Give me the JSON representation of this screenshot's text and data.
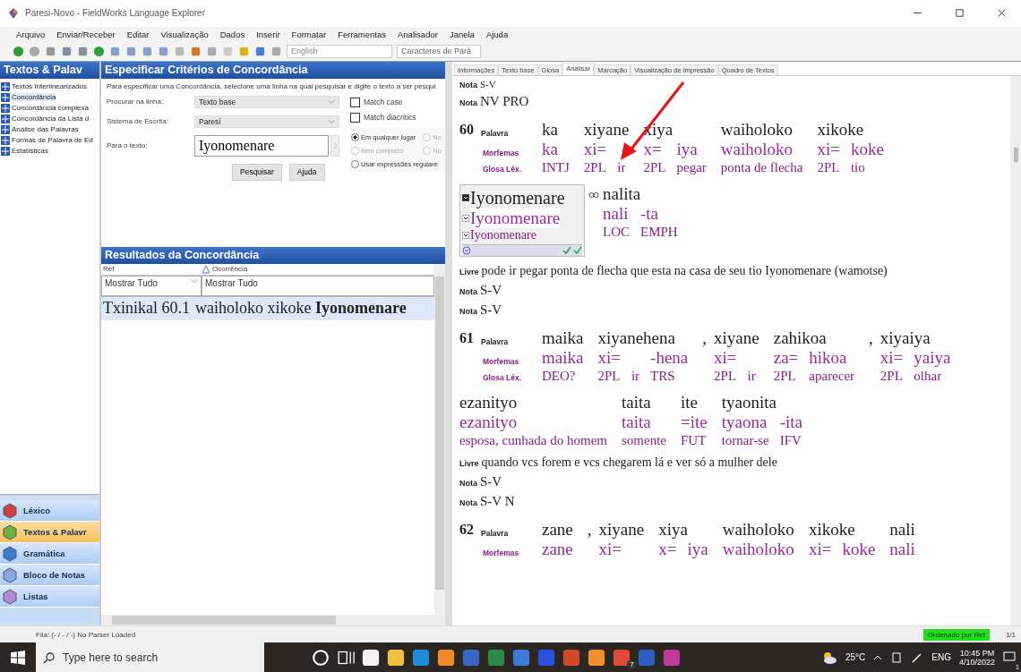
{
  "window": {
    "title": "Paresi-Novo - FieldWorks Language Explorer"
  },
  "menu": [
    "Arquivo",
    "Enviar/Receber",
    "Editar",
    "Visualização",
    "Dados",
    "Inserir",
    "Formatar",
    "Ferramentas",
    "Analisador",
    "Janela",
    "Ajuda"
  ],
  "toolbar": {
    "writing_system": "English",
    "style": "Caracteres de Pará"
  },
  "sidebar": {
    "title": "Textos & Palav",
    "items": [
      {
        "label": "Textos Interlinearizados",
        "selected": false
      },
      {
        "label": "Concordância",
        "selected": true
      },
      {
        "label": "Concordância complexa",
        "selected": false
      },
      {
        "label": "Concordância da Lista d",
        "selected": false
      },
      {
        "label": "Análise das Palavras",
        "selected": false
      },
      {
        "label": "Formas de Palavra de Ed",
        "selected": false
      },
      {
        "label": "Estatísticas",
        "selected": false
      }
    ],
    "areas": [
      {
        "label": "Léxico",
        "selected": false
      },
      {
        "label": "Textos & Palavr",
        "selected": true
      },
      {
        "label": "Gramática",
        "selected": false
      },
      {
        "label": "Bloco de Notas",
        "selected": false
      },
      {
        "label": "Listas",
        "selected": false
      }
    ]
  },
  "criteria": {
    "title": "Especificar Critérios de Concordância",
    "instructions": "Para especificar uma Concordância, selecione uma linha na qual pesquisar e digite o texto a ser pesqui",
    "fields": [
      {
        "label": "Procurar na linha:",
        "value": "Texto base",
        "kind": "combo"
      },
      {
        "label": "Sistema de Escrita:",
        "value": "Paresí",
        "kind": "combo"
      },
      {
        "label": "Para o texto:",
        "value": "Iyonomenare",
        "kind": "text"
      }
    ],
    "checkboxes": [
      {
        "label": "Match case",
        "checked": false
      },
      {
        "label": "Match diacritics",
        "checked": false
      }
    ],
    "match_options": [
      {
        "label": "Em qualquer lugar",
        "selected": true,
        "disabled": false
      },
      {
        "label": "No",
        "selected": false,
        "disabled": true
      },
      {
        "label": "Item completo",
        "selected": false,
        "disabled": true
      },
      {
        "label": "No",
        "selected": false,
        "disabled": true
      },
      {
        "label": "Usar expressões regulare",
        "selected": false,
        "disabled": false
      }
    ],
    "buttons": [
      "Pesquisar",
      "Ajuda"
    ]
  },
  "results": {
    "title": "Resultados da Concordância",
    "columns": [
      {
        "label": "Ref",
        "sorted": false
      },
      {
        "label": "Ocorrência",
        "sorted": true
      }
    ],
    "filters": [
      "Mostrar Tudo",
      "Mostrar Tudo"
    ],
    "rows": [
      {
        "ref": "Txinikal 60.1",
        "occurrence": "waiholoko xikoke **Iyonomenare**",
        "selected": true
      }
    ]
  },
  "text_tabs": [
    {
      "label": "Informações",
      "selected": false
    },
    {
      "label": "Texto base",
      "selected": false
    },
    {
      "label": "Glosa",
      "selected": false
    },
    {
      "label": "Analisar",
      "selected": true
    },
    {
      "label": "Marcação",
      "selected": false
    },
    {
      "label": "Visualização de Impressão",
      "selected": false
    },
    {
      "label": "Quadro de Textos",
      "selected": false
    }
  ],
  "interlinear": [
    {
      "kind": "note",
      "label": "Nota",
      "text": "S-V",
      "small": true
    },
    {
      "kind": "note",
      "label": "Nota",
      "text": "NV PRO",
      "small": false
    },
    {
      "kind": "bundle",
      "number": "60",
      "labels": [
        "Palavra",
        "Morfemas",
        "Glosa Léx."
      ],
      "lines": [
        [
          {
            "kind": "word",
            "word": "ka",
            "morphs": [
              {
                "form": "ka",
                "gloss": "INTJ"
              }
            ]
          },
          {
            "kind": "word",
            "word": "xiyane",
            "morphs": [
              {
                "form": "xi=",
                "gloss": "2PL"
              },
              {
                "gloss": "ir"
              }
            ]
          },
          {
            "kind": "word",
            "word": "xiya",
            "morphs": [
              {
                "form": "x=",
                "gloss": "2PL"
              },
              {
                "form": "iya",
                "gloss": "pegar"
              }
            ]
          },
          {
            "kind": "word",
            "word": "waiholoko",
            "morphs": [
              {
                "form": "waiholoko",
                "gloss": "ponta de flecha"
              }
            ]
          },
          {
            "kind": "word",
            "word": "xikoke",
            "morphs": [
              {
                "form": "xi=",
                "gloss": "2PL"
              },
              {
                "form": "koke",
                "gloss": "tio"
              }
            ]
          }
        ],
        [
          {
            "kind": "sandbox",
            "lines": [
              "Iyonomenare",
              "Iyonomenare",
              "Iyonomenare"
            ]
          },
          {
            "kind": "word",
            "word": "nalita",
            "morphs": [
              {
                "form": "nali",
                "gloss": "LOC"
              },
              {
                "form": "-ta",
                "gloss": "EMPH"
              }
            ]
          }
        ]
      ]
    },
    {
      "kind": "free",
      "label": "Livre",
      "text": "pode ir pegar ponta de flecha que esta na casa de seu tio Iyonomenare (wamotse)"
    },
    {
      "kind": "note",
      "label": "Nota",
      "text": "S-V",
      "small": false
    },
    {
      "kind": "note",
      "label": "Nota",
      "text": "S-V",
      "small": false
    },
    {
      "kind": "bundle",
      "number": "61",
      "labels": [
        "Palavra",
        "Morfemas",
        "Glosa Léx."
      ],
      "lines": [
        [
          {
            "kind": "word",
            "word": "maika",
            "morphs": [
              {
                "form": "maika",
                "gloss": "DEO?"
              }
            ]
          },
          {
            "kind": "word",
            "word": "xiyanehena",
            "morphs": [
              {
                "form": "xi=",
                "gloss": "2PL"
              },
              {
                "gloss": "ir"
              },
              {
                "form": "-hena",
                "gloss": "TRS"
              }
            ]
          },
          {
            "kind": "punct",
            "text": ","
          },
          {
            "kind": "word",
            "word": "xiyane",
            "morphs": [
              {
                "form": "xi=",
                "gloss": "2PL"
              },
              {
                "gloss": "ir"
              }
            ]
          },
          {
            "kind": "word",
            "word": "zahikoa",
            "morphs": [
              {
                "form": "za=",
                "gloss": "2PL"
              },
              {
                "form": "hikoa",
                "gloss": "aparecer"
              }
            ]
          },
          {
            "kind": "punct",
            "text": ","
          },
          {
            "kind": "word",
            "word": "xiyaiya",
            "morphs": [
              {
                "form": "xi=",
                "gloss": "2PL"
              },
              {
                "form": "yaiya",
                "gloss": "olhar"
              }
            ]
          }
        ],
        [
          {
            "kind": "word",
            "word": "ezanityo",
            "morphs": [
              {
                "form": "ezanityo",
                "gloss": "esposa, cunhada do homem"
              }
            ]
          },
          {
            "kind": "word",
            "word": "taita",
            "morphs": [
              {
                "form": "taita",
                "gloss": "somente"
              }
            ]
          },
          {
            "kind": "word",
            "word": "ite",
            "morphs": [
              {
                "form": "=ite",
                "gloss": "FUT"
              }
            ]
          },
          {
            "kind": "word",
            "word": "tyaonita",
            "morphs": [
              {
                "form": "tyaona",
                "gloss": "tornar-se"
              },
              {
                "form": "-ita",
                "gloss": "IFV"
              }
            ]
          }
        ]
      ]
    },
    {
      "kind": "free",
      "label": "Livre",
      "text": "quando vcs forem e vcs chegarem lá e ver só a mulher dele"
    },
    {
      "kind": "note",
      "label": "Nota",
      "text": "S-V",
      "small": false
    },
    {
      "kind": "note",
      "label": "Nota",
      "text": "S-V N",
      "small": false
    },
    {
      "kind": "bundle",
      "number": "62",
      "labels": [
        "Palavra",
        "Morfemas"
      ],
      "lines": [
        [
          {
            "kind": "word",
            "word": "zane",
            "morphs": [
              {
                "form": "zane"
              }
            ]
          },
          {
            "kind": "punct",
            "text": ","
          },
          {
            "kind": "word",
            "word": "xiyane",
            "morphs": [
              {
                "form": "xi="
              }
            ]
          },
          {
            "kind": "word",
            "word": "xiya",
            "morphs": [
              {
                "form": "x="
              },
              {
                "form": "iya"
              }
            ]
          },
          {
            "kind": "word",
            "word": "waiholoko",
            "morphs": [
              {
                "form": "waiholoko"
              }
            ]
          },
          {
            "kind": "word",
            "word": "xikoke",
            "morphs": [
              {
                "form": "xi="
              },
              {
                "form": "koke"
              }
            ]
          },
          {
            "kind": "word",
            "word": "nali",
            "morphs": [
              {
                "form": "nali"
              }
            ]
          }
        ]
      ]
    }
  ],
  "status_bar": {
    "left": "Fila: (- / - / -) No Parser Loaded",
    "sort": "Ordenado por Ref",
    "page": "1/1"
  },
  "taskbar": {
    "search_placeholder": "Type here to search",
    "badge": "7",
    "weather": "25°C",
    "language": "ENG",
    "time": "10:45 PM",
    "date": "4/10/2022",
    "notifications": "1"
  }
}
